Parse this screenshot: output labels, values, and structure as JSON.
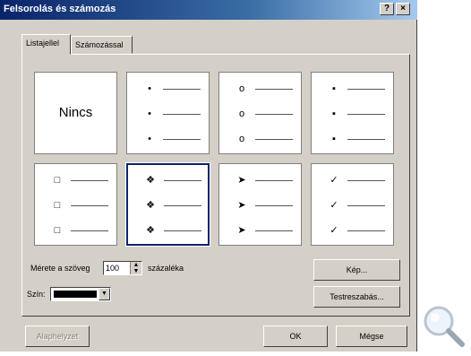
{
  "window": {
    "title": "Felsorolás és számozás",
    "help": "?",
    "close": "×"
  },
  "tabs": [
    {
      "label": "Listajellel"
    },
    {
      "label": "Számozással"
    }
  ],
  "gallery": {
    "none_label": "Nincs",
    "bullets": [
      "•",
      "o",
      "▪",
      "□",
      "❖",
      "➤",
      "✓"
    ]
  },
  "size": {
    "label": "Mérete a szöveg",
    "value": "100",
    "suffix": "százaléka"
  },
  "color": {
    "label": "Szín:",
    "value": "#000000"
  },
  "buttons": {
    "picture": "Kép...",
    "customize": "Testreszabás...",
    "reset": "Alaphelyzet",
    "ok": "OK",
    "cancel": "Mégse"
  }
}
